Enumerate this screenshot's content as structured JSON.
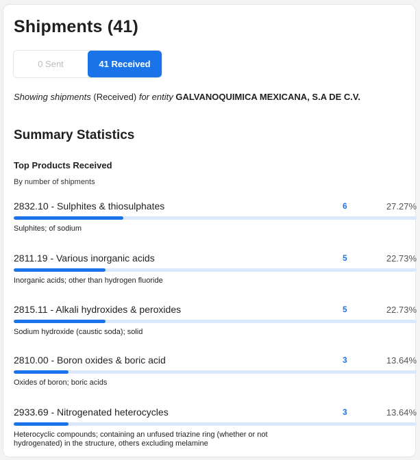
{
  "header": {
    "title": "Shipments (41)"
  },
  "toggle": {
    "sent_label": "0 Sent",
    "received_label": "41 Received",
    "active": "received"
  },
  "showing": {
    "prefix": "Showing shipments",
    "direction": "(Received)",
    "middle": "for entity",
    "entity": "GALVANOQUIMICA MEXICANA, S.A DE C.V."
  },
  "summary": {
    "heading": "Summary Statistics",
    "section_title": "Top Products Received",
    "section_subtitle": "By number of shipments",
    "products": [
      {
        "name": "2832.10 - Sulphites & thiosulphates",
        "count": "6",
        "percent": "27.27%",
        "share": 27.27,
        "description": "Sulphites; of sodium"
      },
      {
        "name": "2811.19 - Various inorganic acids",
        "count": "5",
        "percent": "22.73%",
        "share": 22.73,
        "description": "Inorganic acids; other than hydrogen fluoride"
      },
      {
        "name": "2815.11 - Alkali hydroxides & peroxides",
        "count": "5",
        "percent": "22.73%",
        "share": 22.73,
        "description": "Sodium hydroxide (caustic soda); solid"
      },
      {
        "name": "2810.00 - Boron oxides & boric acid",
        "count": "3",
        "percent": "13.64%",
        "share": 13.64,
        "description": "Oxides of boron; boric acids"
      },
      {
        "name": "2933.69 - Nitrogenated heterocycles",
        "count": "3",
        "percent": "13.64%",
        "share": 13.64,
        "description": "Heterocyclic compounds; containing an unfused triazine ring (whether or not hydrogenated) in the structure, others excluding melamine"
      }
    ]
  },
  "colors": {
    "accent": "#1a73e8",
    "track": "#dbe8fb"
  }
}
